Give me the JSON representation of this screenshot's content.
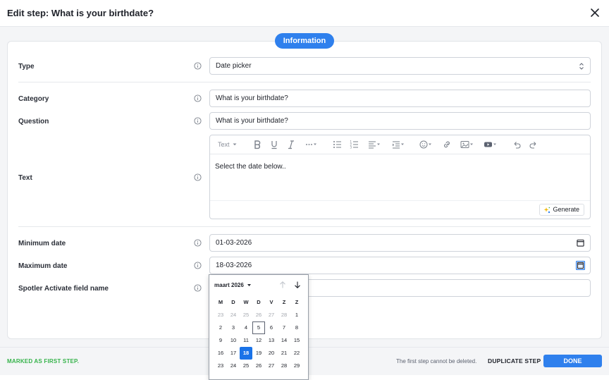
{
  "header": {
    "title": "Edit step: What is your birthdate?"
  },
  "tab_label": "Information",
  "form": {
    "type": {
      "label": "Type",
      "value": "Date picker"
    },
    "category": {
      "label": "Category",
      "value": "What is your birthdate?"
    },
    "question": {
      "label": "Question",
      "value": "What is your birthdate?"
    },
    "text": {
      "label": "Text",
      "content": "Select the date below..",
      "toolbar_text_label": "Text",
      "generate_label": "Generate"
    },
    "min_date": {
      "label": "Minimum date",
      "value": "01-03-2026"
    },
    "max_date": {
      "label": "Maximum date",
      "value": "18-03-2026"
    },
    "spotler": {
      "label": "Spotler Activate field name",
      "value": ""
    }
  },
  "calendar": {
    "month_label": "maart 2026",
    "weekdays": [
      "M",
      "D",
      "W",
      "D",
      "V",
      "Z",
      "Z"
    ],
    "weeks": [
      [
        "23",
        "24",
        "25",
        "26",
        "27",
        "28",
        "1"
      ],
      [
        "2",
        "3",
        "4",
        "5",
        "6",
        "7",
        "8"
      ],
      [
        "9",
        "10",
        "11",
        "12",
        "13",
        "14",
        "15"
      ],
      [
        "16",
        "17",
        "18",
        "19",
        "20",
        "21",
        "22"
      ],
      [
        "23",
        "24",
        "25",
        "26",
        "27",
        "28",
        "29"
      ]
    ],
    "outside_days_first_row": 6,
    "today": "5",
    "selected": "18"
  },
  "footer": {
    "first_step": "MARKED AS FIRST STEP.",
    "note": "The first step cannot be deleted.",
    "duplicate": "DUPLICATE STEP",
    "done": "DONE"
  },
  "colors": {
    "accent": "#2f80ed",
    "success": "#35b34a",
    "selected_day": "#1a73e8"
  }
}
